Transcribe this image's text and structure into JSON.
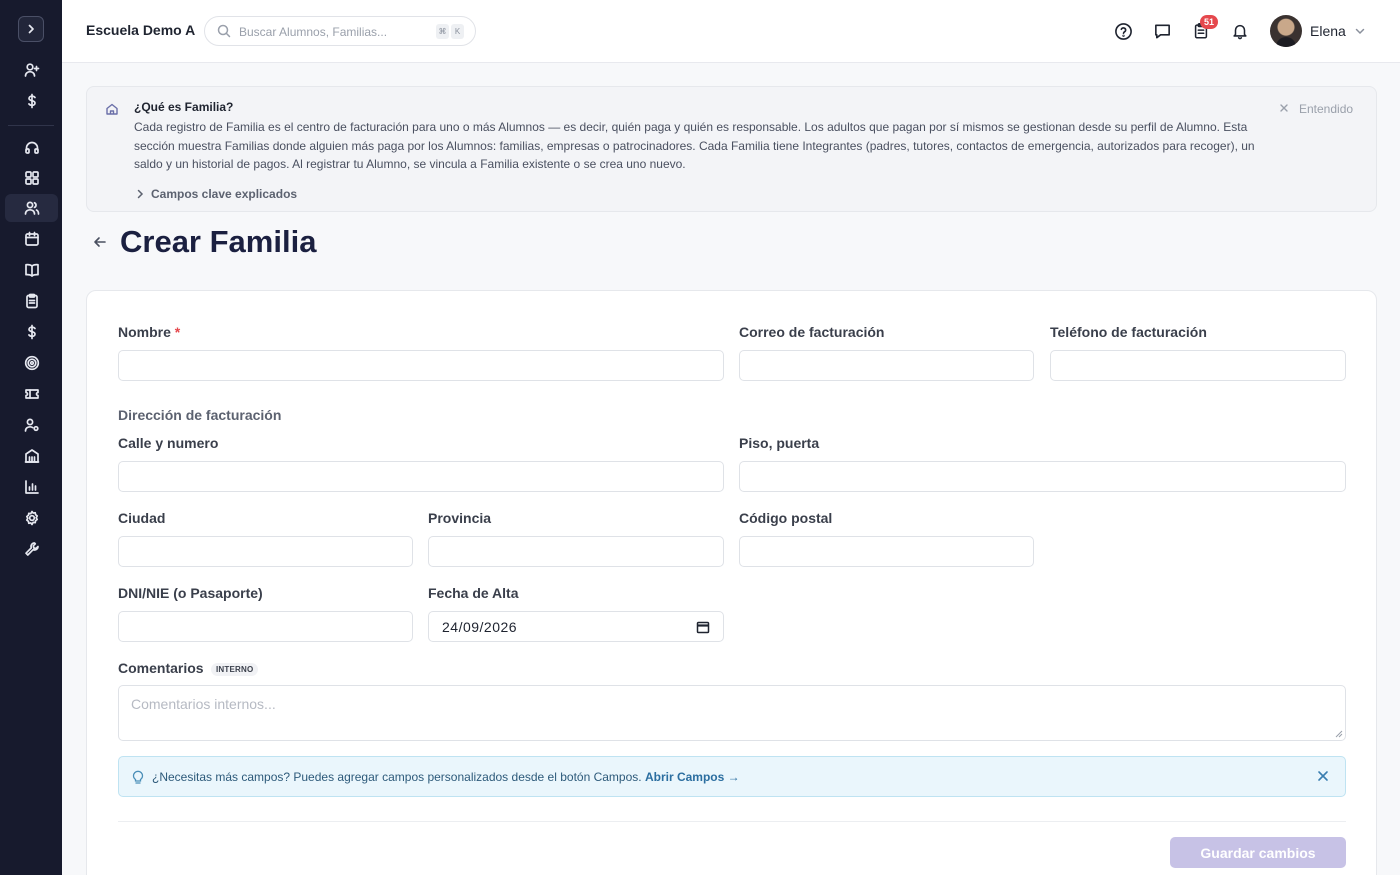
{
  "sidebar": {
    "toggle_icon": "chevron-right-icon",
    "items": [
      {
        "name": "add-user-icon"
      },
      {
        "name": "dollar-icon"
      },
      {
        "name": "headset-icon"
      },
      {
        "name": "dashboard-icon"
      },
      {
        "name": "users-icon",
        "active": true
      },
      {
        "name": "calendar-icon"
      },
      {
        "name": "book-icon"
      },
      {
        "name": "clipboard-icon"
      },
      {
        "name": "dollar-icon"
      },
      {
        "name": "target-icon"
      },
      {
        "name": "ticket-icon"
      },
      {
        "name": "user-gear-icon"
      },
      {
        "name": "building-icon"
      },
      {
        "name": "chart-icon"
      },
      {
        "name": "settings-icon"
      },
      {
        "name": "wrench-icon"
      }
    ]
  },
  "header": {
    "school_name": "Escuela Demo A",
    "search_placeholder": "Buscar Alumnos, Familias...",
    "shortcut_keys": [
      "⌘",
      "K"
    ],
    "tasks_badge": "51",
    "user_name": "Elena"
  },
  "info_panel": {
    "title": "¿Qué es Familia?",
    "text": "Cada registro de Familia es el centro de facturación para uno o más Alumnos — es decir, quién paga y quién es responsable. Los adultos que pagan por sí mismos se gestionan desde su perfil de Alumno. Esta sección muestra Familias donde alguien más paga por los Alumnos: familias, empresas o patrocinadores. Cada Familia tiene Integrantes (padres, tutores, contactos de emergencia, autorizados para recoger), un saldo y un historial de pagos. Al registrar tu Alumno, se vincula a Familia existente o se crea uno nuevo.",
    "dismiss_label": "Entendido",
    "expand_label": "Campos clave explicados"
  },
  "page": {
    "title": "Crear Familia"
  },
  "form": {
    "name_label": "Nombre",
    "required_mark": "*",
    "billing_email_label": "Correo de facturación",
    "billing_phone_label": "Teléfono de facturación",
    "address_section_label": "Dirección de facturación",
    "street_label": "Calle y numero",
    "floor_label": "Piso, puerta",
    "city_label": "Ciudad",
    "province_label": "Provincia",
    "postal_code_label": "Código postal",
    "id_label": "DNI/NIE (o Pasaporte)",
    "signup_date_label": "Fecha de Alta",
    "signup_date_value": "24/09/2026",
    "comments_label": "Comentarios",
    "comments_tag": "INTERNO",
    "comments_placeholder": "Comentarios internos...",
    "tip_text": "¿Necesitas más campos? Puedes agregar campos personalizados desde el botón Campos.",
    "tip_link": "Abrir Campos →",
    "save_label": "Guardar cambios"
  },
  "colors": {
    "sidebar_bg": "#171a2d",
    "title": "#1b2040",
    "badge": "#e5484d",
    "save_disabled": "#c7c2e6",
    "tip_bg": "#eaf6fc"
  }
}
